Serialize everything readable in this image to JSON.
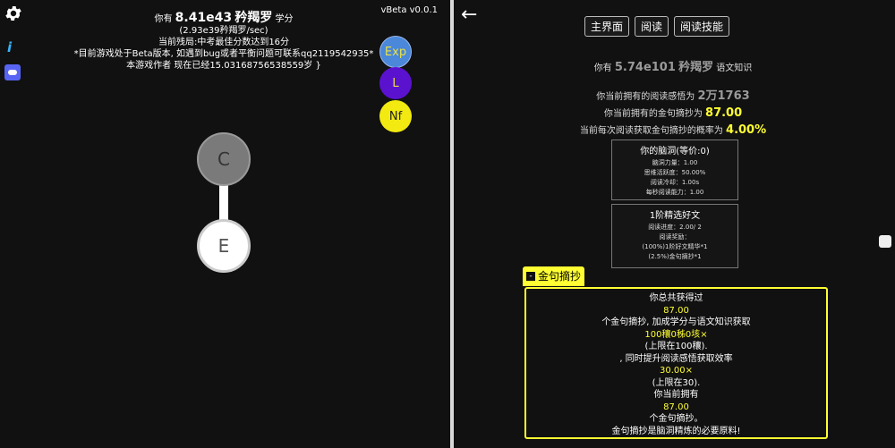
{
  "left": {
    "version": "vBeta v0.0.1",
    "stats": {
      "line1_prefix": "你有",
      "points": "8.41e43",
      "unit": "矜羯罗",
      "line1_suffix": "学分",
      "rate": "(2.93e39矜羯罗/sec)",
      "progress": "当前残局:中考最佳分数达到16分",
      "notice": "*目前游戏处于Beta版本, 如遇到bug或者平衡问题可联系qq2119542935*",
      "age": "本游戏作者 现在已经15.03168756538559岁 }"
    },
    "buttons": {
      "exp": "Exp",
      "l": "L",
      "nf": "Nf"
    },
    "nodes": {
      "c": "C",
      "e": "E"
    },
    "icons": {
      "settings": "gear-icon",
      "info": "i",
      "discord": "discord-icon"
    }
  },
  "right": {
    "back_label": "←",
    "tabs": [
      "主界面",
      "阅读",
      "阅读技能"
    ],
    "knowledge": {
      "prefix": "你有",
      "value": "5.74e101",
      "unit": "矜羯罗",
      "suffix": "语文知识"
    },
    "reading": {
      "label": "你当前拥有的阅读感悟为",
      "value": "2万1763"
    },
    "golden": {
      "label": "你当前拥有的金句摘抄为",
      "value": "87.00"
    },
    "chance": {
      "label": "当前每次阅读获取金句摘抄的概率为",
      "value": "4.00%"
    },
    "brain_panel": {
      "title": "你的脑洞(等价:0)",
      "lines": [
        "脑洞力量：1.00",
        "思维活跃度：50.00%",
        "阅读冷却：1.00s",
        "每秒阅读能力：1.00"
      ]
    },
    "essay_panel": {
      "title": "1阶精选好文",
      "lines": [
        "阅读进度：2.00/ 2",
        "阅读奖励：",
        "(100%)1阶好文精华*1",
        "(2.5%)金句摘抄*1"
      ]
    },
    "gold_tab": {
      "minus": "-",
      "label": "金句摘抄"
    },
    "gold_box": [
      {
        "text": "你总共获得过",
        "hl": false
      },
      {
        "text": "87.00",
        "hl": true
      },
      {
        "text": "个金句摘抄, 加成学分与语文知识获取",
        "hl": false
      },
      {
        "text": "100穰0秭0垓×",
        "hl": true
      },
      {
        "text": "(上限在100穰).",
        "hl": false
      },
      {
        "text": ", 同时提升阅读感悟获取效率",
        "hl": false
      },
      {
        "text": "30.00×",
        "hl": true
      },
      {
        "text": "(上限在30).",
        "hl": false
      },
      {
        "text": "你当前拥有",
        "hl": false
      },
      {
        "text": "87.00",
        "hl": true
      },
      {
        "text": "个金句摘抄。",
        "hl": false
      },
      {
        "text": "金句摘抄是脑洞精炼的必要原料!",
        "hl": false
      }
    ]
  }
}
